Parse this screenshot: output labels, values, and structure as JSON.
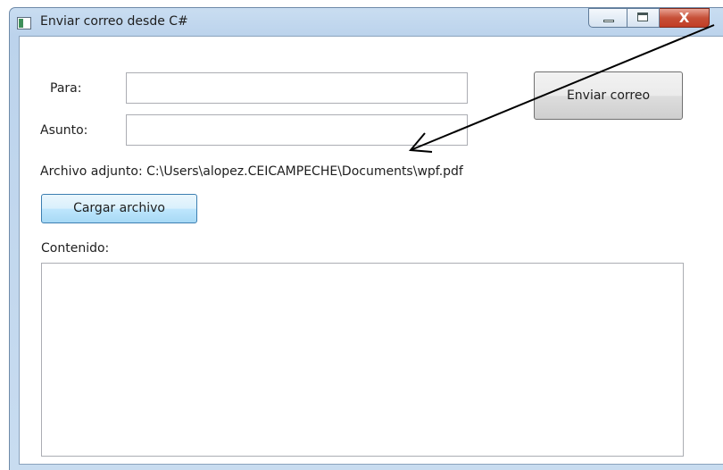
{
  "window": {
    "title": "Enviar correo desde C#",
    "minimize_icon": "minimize-icon",
    "maximize_icon": "maximize-icon",
    "close_glyph": "X"
  },
  "form": {
    "para_label": "Para:",
    "para_value": "",
    "asunto_label": "Asunto:",
    "asunto_value": "",
    "send_button": "Enviar correo",
    "attachment_text": "Archivo adjunto: C:\\Users\\alopez.CEICAMPECHE\\Documents\\wpf.pdf",
    "load_button": "Cargar archivo",
    "contenido_label": "Contenido:",
    "contenido_value": ""
  },
  "annotation": {
    "arrow_color": "#000000"
  }
}
